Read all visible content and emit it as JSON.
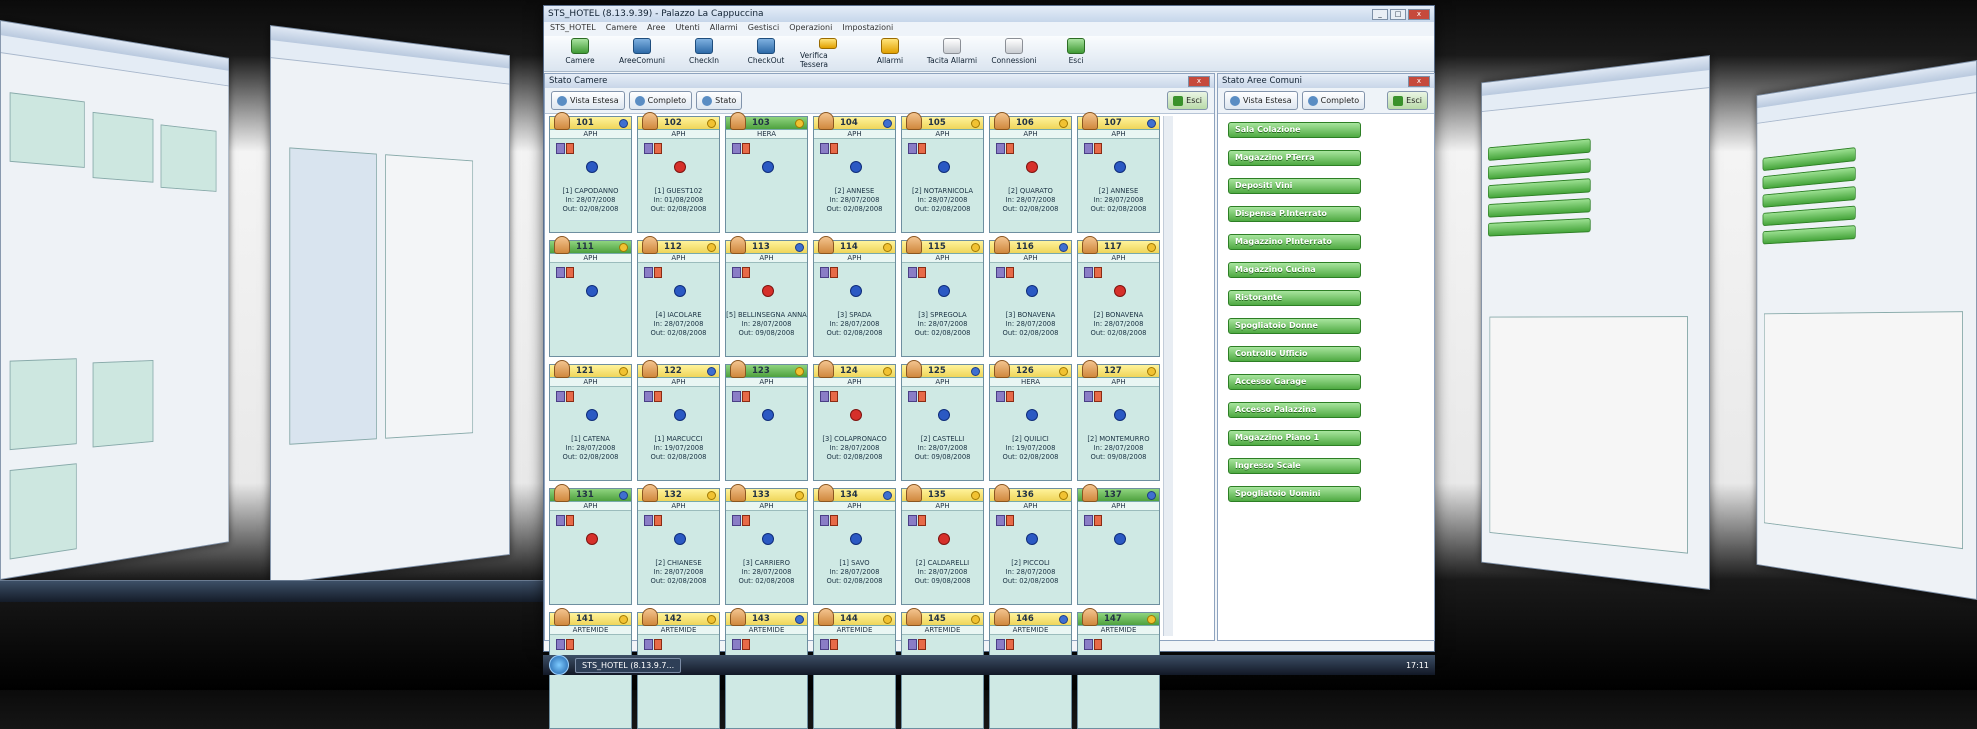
{
  "window": {
    "title": "STS_HOTEL (8.13.9.39) - Palazzo La Cappuccina",
    "menu": [
      "STS_HOTEL",
      "Camere",
      "Aree",
      "Utenti",
      "Allarmi",
      "Gestisci",
      "Operazioni",
      "Impostazioni"
    ],
    "toolbar": [
      "Camere",
      "AreeComuni",
      "CheckIn",
      "CheckOut",
      "Verifica Tessera",
      "Allarmi",
      "Tacita Allarmi",
      "Connessioni",
      "Esci"
    ]
  },
  "stanze": {
    "title": "Stato Camere",
    "buttons": {
      "vista": "Vista Estesa",
      "completo": "Completo",
      "stato": "Stato",
      "esci": "Esci"
    },
    "rooms": [
      {
        "num": "101",
        "type": "APH",
        "hd": "yellow",
        "line1": "[1] CAPODANNO",
        "line2": "In: 28/07/2008",
        "line3": "Out: 02/08/2008"
      },
      {
        "num": "102",
        "type": "APH",
        "hd": "yellow",
        "line1": "[1] GUEST102",
        "line2": "In: 01/08/2008",
        "line3": "Out: 02/08/2008"
      },
      {
        "num": "103",
        "type": "HERA",
        "hd": "green",
        "line1": "",
        "line2": "",
        "line3": ""
      },
      {
        "num": "104",
        "type": "APH",
        "hd": "yellow",
        "line1": "[2] ANNESE",
        "line2": "In: 28/07/2008",
        "line3": "Out: 02/08/2008"
      },
      {
        "num": "105",
        "type": "APH",
        "hd": "yellow",
        "line1": "[2] NOTARNICOLA",
        "line2": "In: 28/07/2008",
        "line3": "Out: 02/08/2008"
      },
      {
        "num": "106",
        "type": "APH",
        "hd": "yellow",
        "line1": "[2] QUARATO",
        "line2": "In: 28/07/2008",
        "line3": "Out: 02/08/2008"
      },
      {
        "num": "107",
        "type": "APH",
        "hd": "yellow",
        "line1": "[2] ANNESE",
        "line2": "In: 28/07/2008",
        "line3": "Out: 02/08/2008"
      },
      {
        "num": "111",
        "type": "APH",
        "hd": "green",
        "line1": "",
        "line2": "",
        "line3": ""
      },
      {
        "num": "112",
        "type": "APH",
        "hd": "yellow",
        "line1": "[4] IACOLARE",
        "line2": "In: 28/07/2008",
        "line3": "Out: 02/08/2008"
      },
      {
        "num": "113",
        "type": "APH",
        "hd": "yellow",
        "line1": "[5] BELLINSEGNA ANNA",
        "line2": "In: 28/07/2008",
        "line3": "Out: 09/08/2008"
      },
      {
        "num": "114",
        "type": "APH",
        "hd": "yellow",
        "line1": "[3] SPADA",
        "line2": "In: 28/07/2008",
        "line3": "Out: 02/08/2008"
      },
      {
        "num": "115",
        "type": "APH",
        "hd": "yellow",
        "line1": "[3] SPREGOLA",
        "line2": "In: 28/07/2008",
        "line3": "Out: 02/08/2008"
      },
      {
        "num": "116",
        "type": "APH",
        "hd": "yellow",
        "line1": "[3] BONAVENA",
        "line2": "In: 28/07/2008",
        "line3": "Out: 02/08/2008"
      },
      {
        "num": "117",
        "type": "APH",
        "hd": "yellow",
        "line1": "[2] BONAVENA",
        "line2": "In: 28/07/2008",
        "line3": "Out: 02/08/2008"
      },
      {
        "num": "121",
        "type": "APH",
        "hd": "yellow",
        "line1": "[1] CATENA",
        "line2": "In: 28/07/2008",
        "line3": "Out: 02/08/2008"
      },
      {
        "num": "122",
        "type": "APH",
        "hd": "yellow",
        "line1": "[1] MARCUCCI",
        "line2": "In: 19/07/2008",
        "line3": "Out: 02/08/2008"
      },
      {
        "num": "123",
        "type": "APH",
        "hd": "green",
        "line1": "",
        "line2": "",
        "line3": ""
      },
      {
        "num": "124",
        "type": "APH",
        "hd": "yellow",
        "line1": "[3] COLAPRONACO",
        "line2": "In: 28/07/2008",
        "line3": "Out: 02/08/2008"
      },
      {
        "num": "125",
        "type": "APH",
        "hd": "yellow",
        "line1": "[2] CASTELLI",
        "line2": "In: 28/07/2008",
        "line3": "Out: 09/08/2008"
      },
      {
        "num": "126",
        "type": "HERA",
        "hd": "yellow",
        "line1": "[2] QUILICI",
        "line2": "In: 19/07/2008",
        "line3": "Out: 02/08/2008"
      },
      {
        "num": "127",
        "type": "APH",
        "hd": "yellow",
        "line1": "[2] MONTEMURRO",
        "line2": "In: 28/07/2008",
        "line3": "Out: 09/08/2008"
      },
      {
        "num": "131",
        "type": "APH",
        "hd": "green",
        "line1": "",
        "line2": "",
        "line3": ""
      },
      {
        "num": "132",
        "type": "APH",
        "hd": "yellow",
        "line1": "[2] CHIANESE",
        "line2": "In: 28/07/2008",
        "line3": "Out: 02/08/2008"
      },
      {
        "num": "133",
        "type": "APH",
        "hd": "yellow",
        "line1": "[3] CARRIERO",
        "line2": "In: 28/07/2008",
        "line3": "Out: 02/08/2008"
      },
      {
        "num": "134",
        "type": "APH",
        "hd": "yellow",
        "line1": "[1] SAVO",
        "line2": "In: 28/07/2008",
        "line3": "Out: 02/08/2008"
      },
      {
        "num": "135",
        "type": "APH",
        "hd": "yellow",
        "line1": "[2] CALDARELLI",
        "line2": "In: 28/07/2008",
        "line3": "Out: 09/08/2008"
      },
      {
        "num": "136",
        "type": "APH",
        "hd": "yellow",
        "line1": "[2] PICCOLI",
        "line2": "In: 28/07/2008",
        "line3": "Out: 02/08/2008"
      },
      {
        "num": "137",
        "type": "APH",
        "hd": "green",
        "line1": "",
        "line2": "",
        "line3": ""
      },
      {
        "num": "141",
        "type": "ARTEMIDE",
        "hd": "yellow",
        "line1": "",
        "line2": "",
        "line3": ""
      },
      {
        "num": "142",
        "type": "ARTEMIDE",
        "hd": "yellow",
        "line1": "",
        "line2": "",
        "line3": ""
      },
      {
        "num": "143",
        "type": "ARTEMIDE",
        "hd": "yellow",
        "line1": "",
        "line2": "",
        "line3": ""
      },
      {
        "num": "144",
        "type": "ARTEMIDE",
        "hd": "yellow",
        "line1": "",
        "line2": "",
        "line3": ""
      },
      {
        "num": "145",
        "type": "ARTEMIDE",
        "hd": "yellow",
        "line1": "",
        "line2": "",
        "line3": ""
      },
      {
        "num": "146",
        "type": "ARTEMIDE",
        "hd": "yellow",
        "line1": "",
        "line2": "",
        "line3": ""
      },
      {
        "num": "147",
        "type": "ARTEMIDE",
        "hd": "green",
        "line1": "",
        "line2": "",
        "line3": ""
      }
    ]
  },
  "aree": {
    "title": "Stato Aree Comuni",
    "buttons": {
      "vista": "Vista Estesa",
      "completo": "Completo",
      "esci": "Esci"
    },
    "items": [
      "Sala Colazione",
      "Magazzino PTerra",
      "Depositi Vini",
      "Dispensa P.Interrato",
      "Magazzino PInterrato",
      "Magazzino Cucina",
      "Ristorante",
      "Spogliatoio Donne",
      "Controllo Ufficio",
      "Accesso Garage",
      "Accesso Palazzina",
      "Magazzino Piano 1",
      "Ingresso Scale",
      "Spogliatoio Uomini"
    ]
  },
  "taskbar": {
    "app": "STS_HOTEL (8.13.9.7...",
    "clock": "17:11"
  }
}
